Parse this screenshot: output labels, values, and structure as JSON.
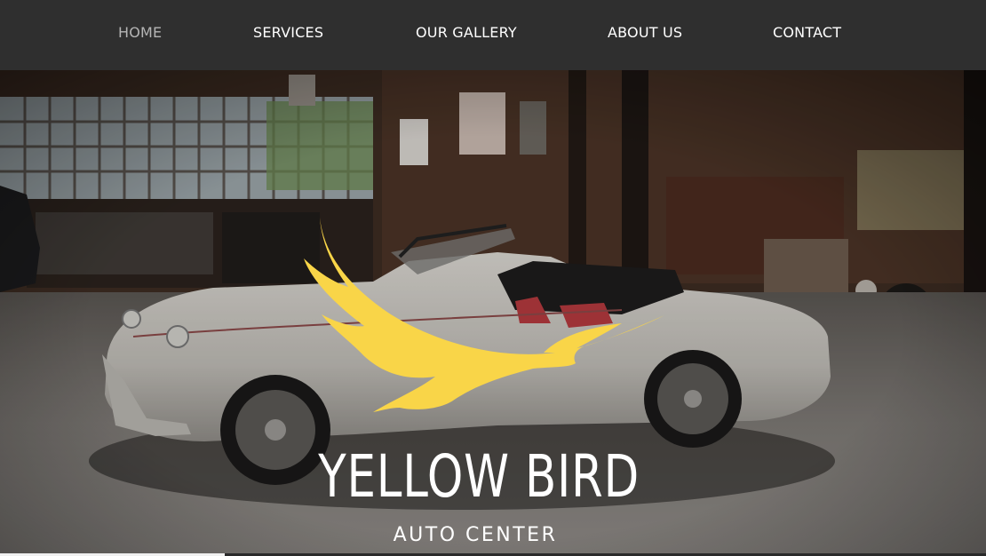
{
  "nav": {
    "items": [
      {
        "label": "HOME",
        "active": true
      },
      {
        "label": "SERVICES",
        "active": false
      },
      {
        "label": "OUR GALLERY",
        "active": false
      },
      {
        "label": "ABOUT US",
        "active": false
      },
      {
        "label": "CONTACT",
        "active": false
      }
    ]
  },
  "hero": {
    "title": "YELLOW BIRD",
    "subtitle": "AUTO CENTER",
    "logo_icon": "yellow-bird-icon",
    "background": "vintage-garage-photo"
  },
  "colors": {
    "navbar_bg": "#2f2f2f",
    "nav_text": "#ffffff",
    "nav_active_text": "#b5b5b5",
    "logo_yellow": "#f9d548",
    "title_text": "#ffffff"
  }
}
